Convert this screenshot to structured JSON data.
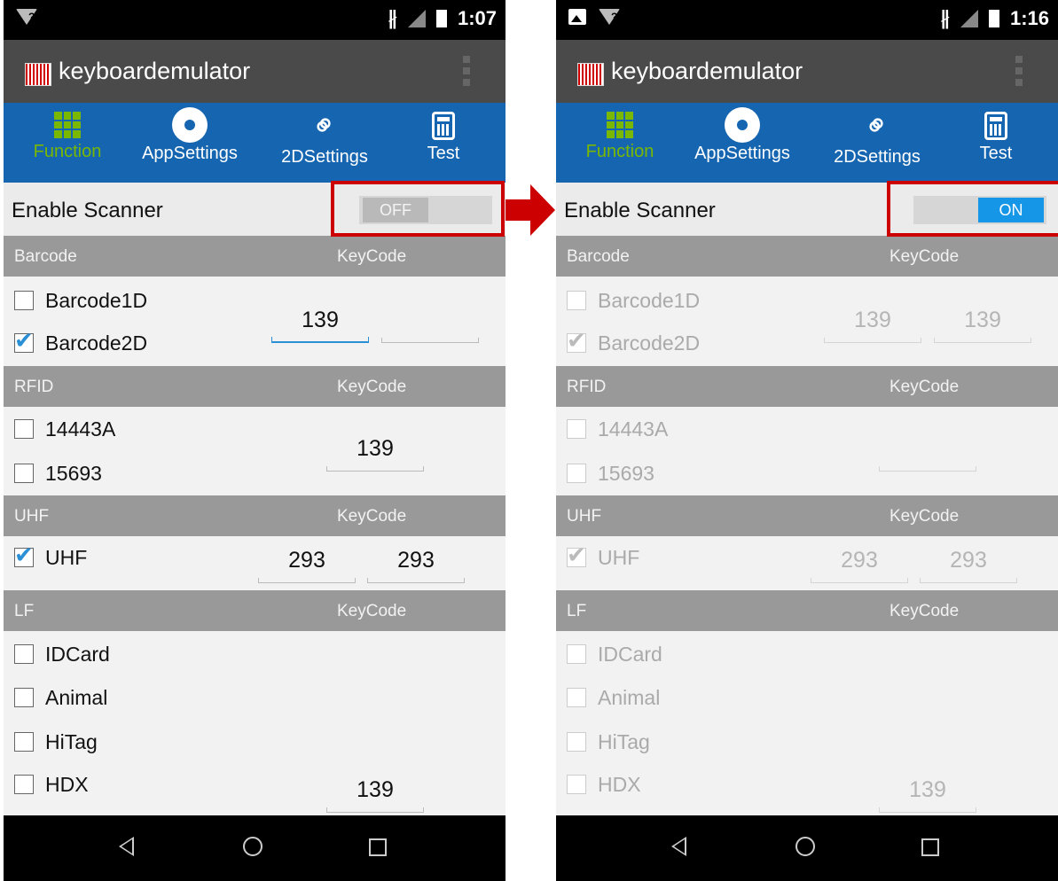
{
  "left": {
    "status": {
      "time": "1:07"
    },
    "app_title": "keyboardemulator",
    "tabs": [
      "Function",
      "AppSettings",
      "2DSettings",
      "Test"
    ],
    "enable_label": "Enable Scanner",
    "switch_label": "OFF",
    "sections": {
      "barcode": {
        "title": "Barcode",
        "keycode": "KeyCode"
      },
      "rfid": {
        "title": "RFID",
        "keycode": "KeyCode"
      },
      "uhf": {
        "title": "UHF",
        "keycode": "KeyCode"
      },
      "lf": {
        "title": "LF",
        "keycode": "KeyCode"
      }
    },
    "items": {
      "barcode1d": "Barcode1D",
      "barcode2d": "Barcode2D",
      "r14443a": "14443A",
      "r15693": "15693",
      "uhf": "UHF",
      "idcard": "IDCard",
      "animal": "Animal",
      "hitag": "HiTag",
      "hdx": "HDX"
    },
    "keycodes": {
      "barcode_a": "139",
      "barcode_b": "",
      "rfid": "139",
      "uhf_a": "293",
      "uhf_b": "293",
      "lf": "139"
    }
  },
  "right": {
    "status": {
      "time": "1:16"
    },
    "app_title": "keyboardemulator",
    "tabs": [
      "Function",
      "AppSettings",
      "2DSettings",
      "Test"
    ],
    "enable_label": "Enable Scanner",
    "switch_label": "ON",
    "sections": {
      "barcode": {
        "title": "Barcode",
        "keycode": "KeyCode"
      },
      "rfid": {
        "title": "RFID",
        "keycode": "KeyCode"
      },
      "uhf": {
        "title": "UHF",
        "keycode": "KeyCode"
      },
      "lf": {
        "title": "LF",
        "keycode": "KeyCode"
      }
    },
    "items": {
      "barcode1d": "Barcode1D",
      "barcode2d": "Barcode2D",
      "r14443a": "14443A",
      "r15693": "15693",
      "uhf": "UHF",
      "idcard": "IDCard",
      "animal": "Animal",
      "hitag": "HiTag",
      "hdx": "HDX"
    },
    "keycodes": {
      "barcode_a": "139",
      "barcode_b": "139",
      "rfid": "",
      "uhf_a": "293",
      "uhf_b": "293",
      "lf": "139"
    }
  },
  "colors": {
    "tab_bar": "#1565b0",
    "active_tab": "#7ab800",
    "switch_on": "#1596e6",
    "highlight": "#cc0000"
  }
}
